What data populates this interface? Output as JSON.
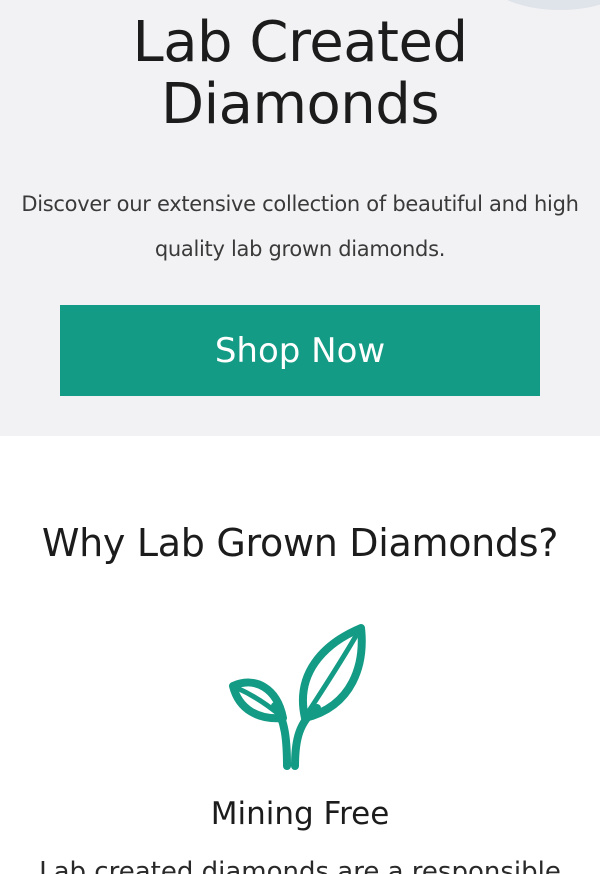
{
  "hero": {
    "title": "Lab Created Diamonds",
    "description": "Discover our extensive collection of beautiful and high quality lab grown diamonds.",
    "shop_button_label": "Shop Now"
  },
  "why_section": {
    "title": "Why Lab Grown Diamonds?",
    "feature": {
      "icon": "sprout-leaf-icon",
      "title": "Mining Free",
      "description": "Lab created diamonds are a responsible"
    }
  },
  "colors": {
    "accent": "#149b85",
    "hero_background": "#f2f2f4",
    "text": "#1c1c1c"
  }
}
